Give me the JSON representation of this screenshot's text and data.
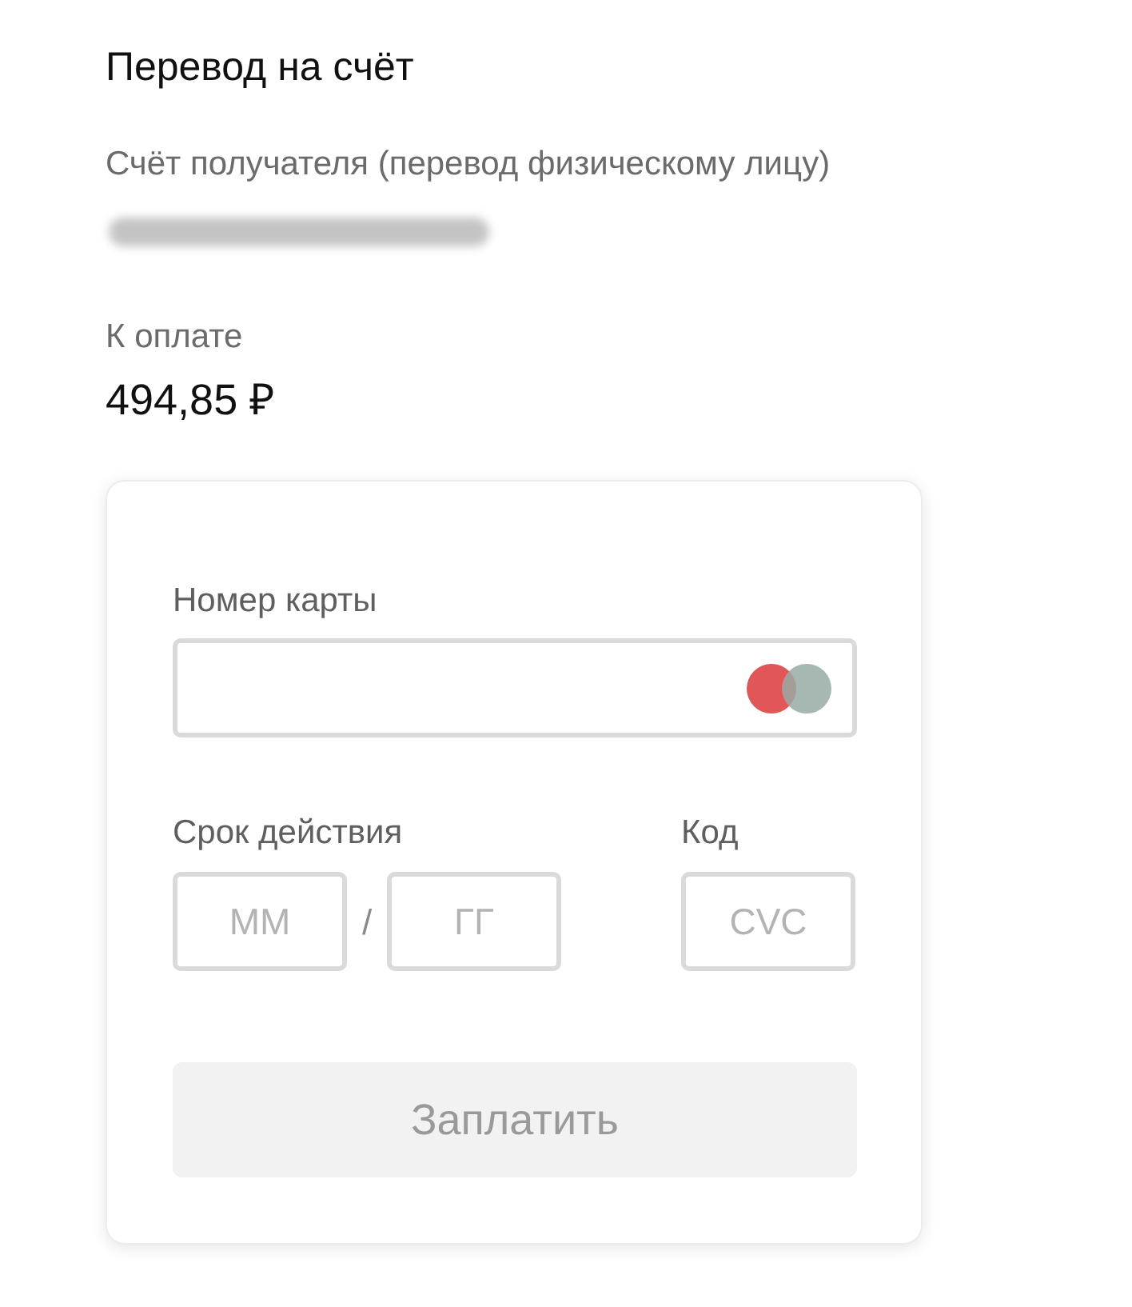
{
  "title": "Перевод на счёт",
  "recipient": {
    "label": "Счёт получателя (перевод физическому лицу)",
    "value_blurred": true
  },
  "amount": {
    "label": "К оплате",
    "value": "494,85 ₽"
  },
  "card_form": {
    "card_number": {
      "label": "Номер карты"
    },
    "expiry": {
      "label": "Срок действия",
      "month_placeholder": "ММ",
      "separator": "/",
      "year_placeholder": "ГГ"
    },
    "code": {
      "label": "Код",
      "placeholder": "CVC"
    },
    "pay_button": {
      "label": "Заплатить",
      "disabled": true
    }
  }
}
